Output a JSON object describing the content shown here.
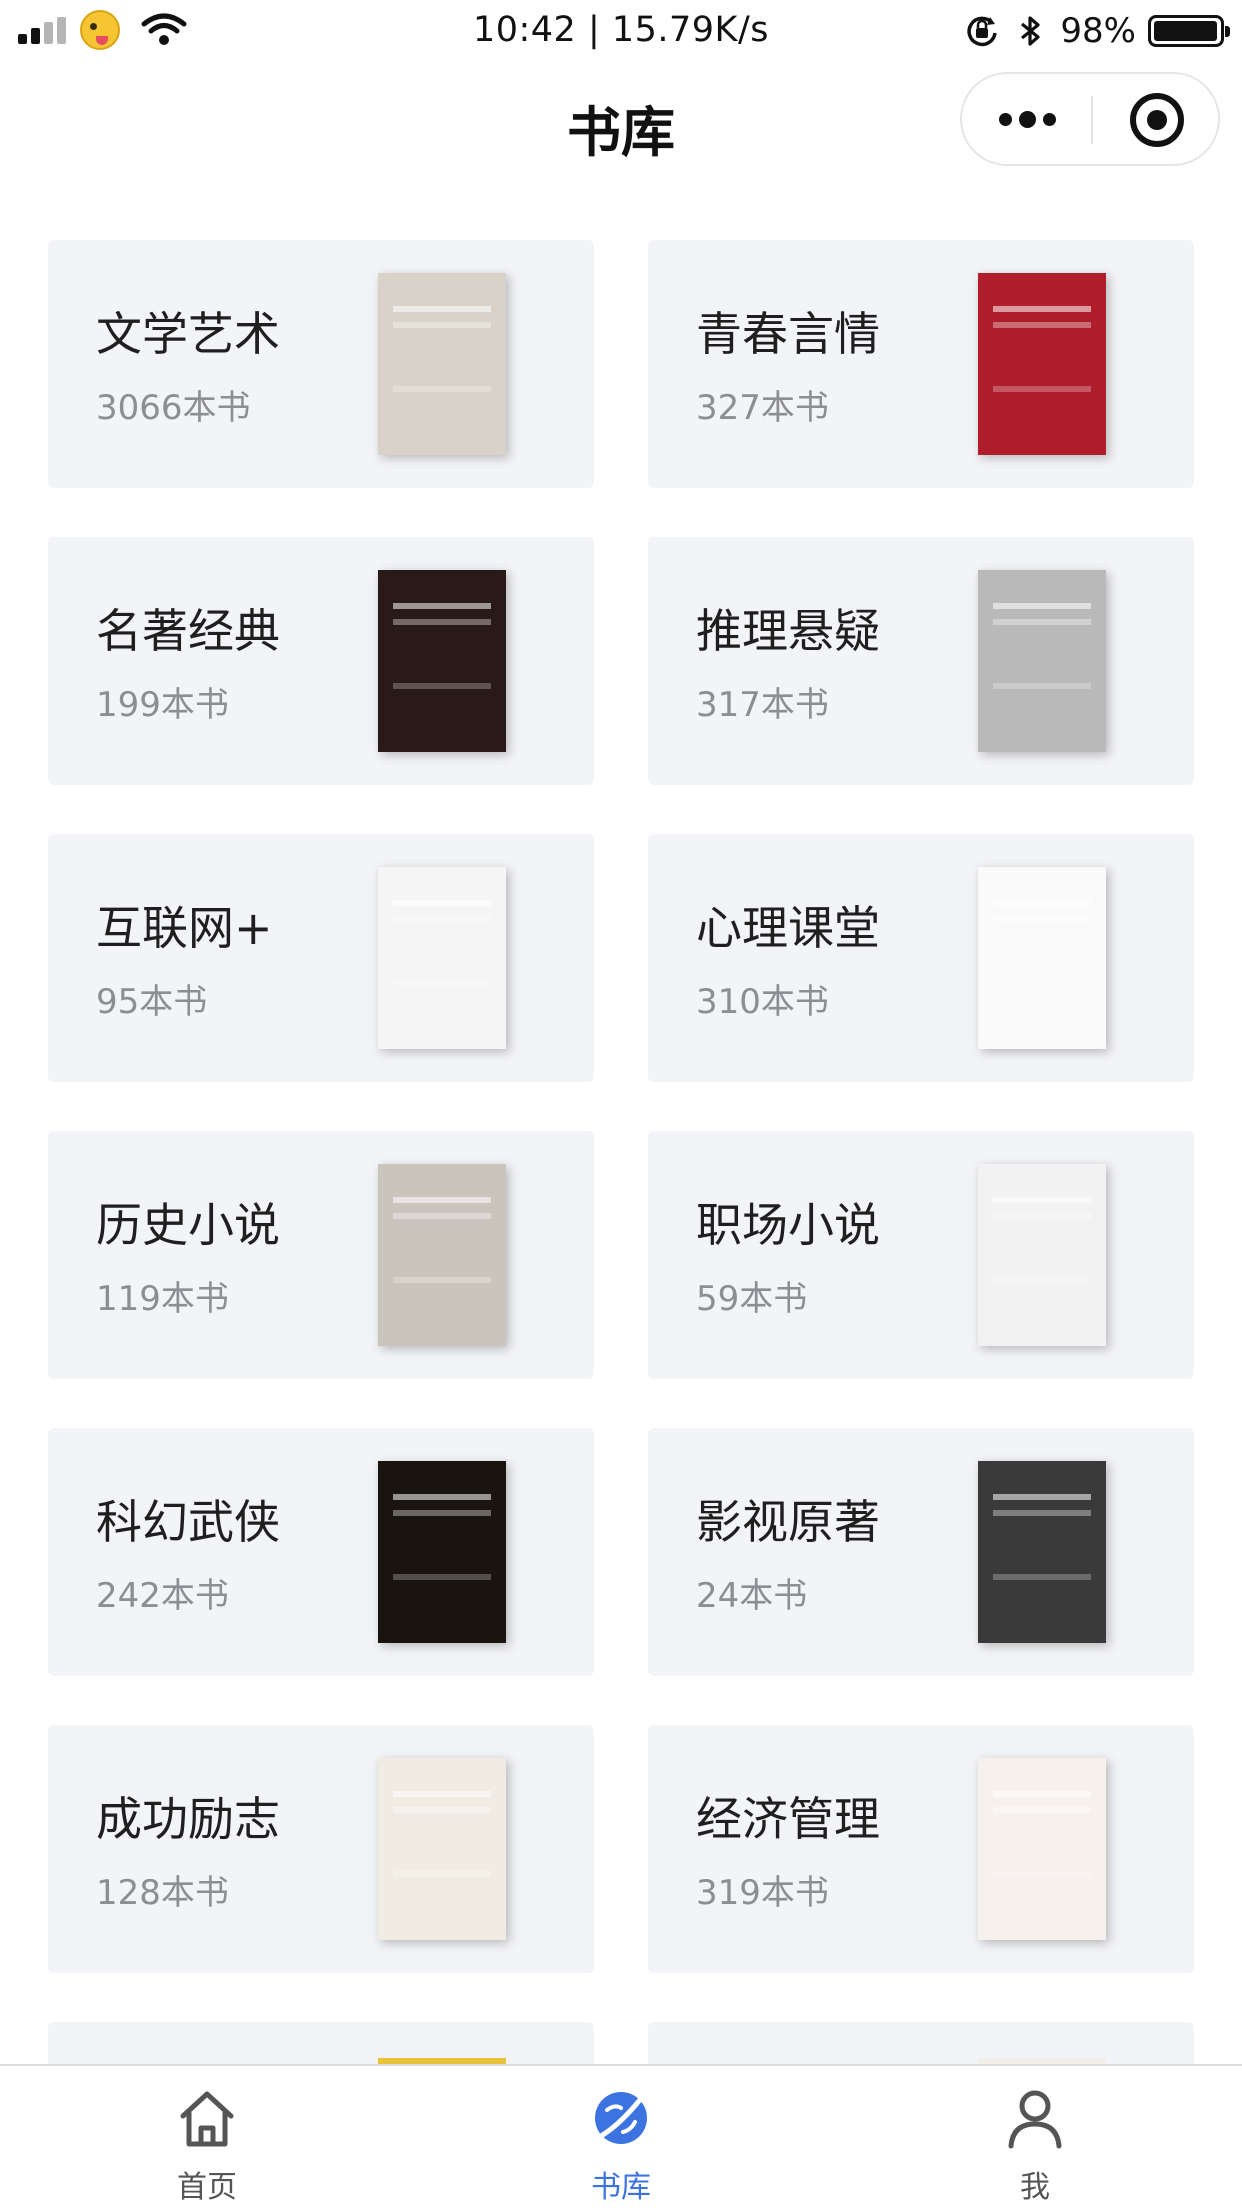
{
  "status_bar": {
    "time": "10:42 | 15.79K/s",
    "battery_percent": "98%",
    "battery_level": 0.98
  },
  "nav": {
    "title": "书库"
  },
  "colors": {
    "accent": "#3d73e0",
    "card_bg": "#f3f4f7",
    "count_text": "#8d8e93"
  },
  "categories": [
    {
      "name": "文学艺术",
      "count": "3066本书",
      "front_cover": "#d8d2c8",
      "back_cover": "#1a2038"
    },
    {
      "name": "青春言情",
      "count": "327本书",
      "front_cover": "#b01e2c",
      "back_cover": "#e8e4da"
    },
    {
      "name": "名著经典",
      "count": "199本书",
      "front_cover": "#2a1a17",
      "back_cover": "#5f8fa8"
    },
    {
      "name": "推理悬疑",
      "count": "317本书",
      "front_cover": "#b9b9b9",
      "back_cover": "#2b1e1e"
    },
    {
      "name": "互联网+",
      "count": "95本书",
      "front_cover": "#f5f5f5",
      "back_cover": "#1f6f78"
    },
    {
      "name": "心理课堂",
      "count": "310本书",
      "front_cover": "#fafafa",
      "back_cover": "#1e2f7a"
    },
    {
      "name": "历史小说",
      "count": "119本书",
      "front_cover": "#c9c4bc",
      "back_cover": "#141636"
    },
    {
      "name": "职场小说",
      "count": "59本书",
      "front_cover": "#f2f2f2",
      "back_cover": "#7a1c2c"
    },
    {
      "name": "科幻武侠",
      "count": "242本书",
      "front_cover": "#1a1410",
      "back_cover": "#2a2050"
    },
    {
      "name": "影视原著",
      "count": "24本书",
      "front_cover": "#3a3a3a",
      "back_cover": "#b3302a"
    },
    {
      "name": "成功励志",
      "count": "128本书",
      "front_cover": "#f0ece4",
      "back_cover": "#1c1c1c"
    },
    {
      "name": "经济管理",
      "count": "319本书",
      "front_cover": "#f7f1ee",
      "back_cover": "#6b4a2a"
    }
  ],
  "tabs": [
    {
      "label": "首页",
      "icon": "home-icon",
      "active": false
    },
    {
      "label": "书库",
      "icon": "planet-icon",
      "active": true
    },
    {
      "label": "我",
      "icon": "user-icon",
      "active": false
    }
  ]
}
